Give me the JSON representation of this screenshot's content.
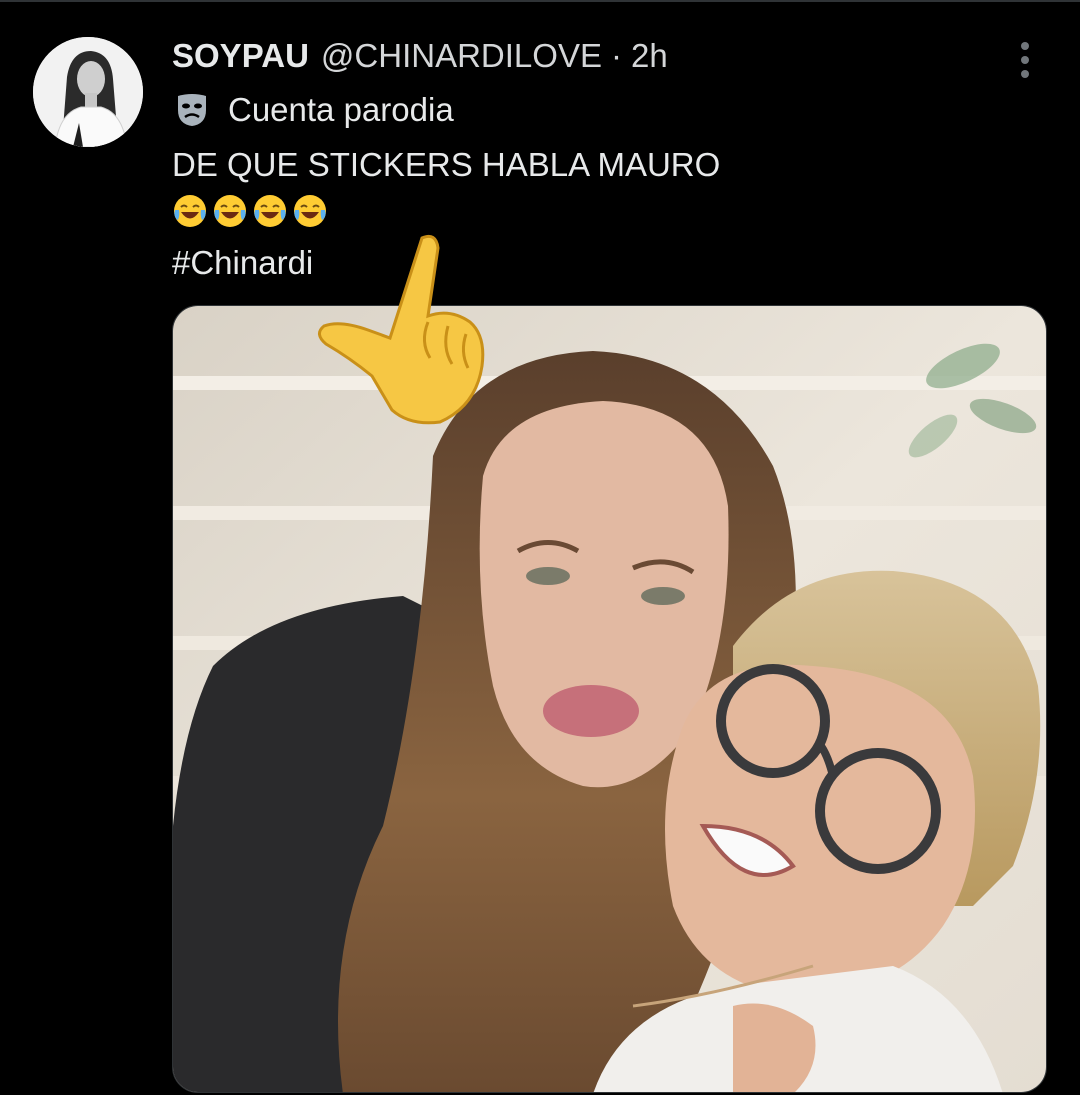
{
  "tweet": {
    "display_name": "SOYPAU",
    "handle": "@CHINARDILOVE",
    "separator": "·",
    "time": "2h",
    "parody_label": "Cuenta parodia",
    "text_line1": "DE QUE STICKERS HABLA MAURO",
    "text_line2_emojis": [
      "face-with-tears-of-joy",
      "face-with-tears-of-joy",
      "face-with-tears-of-joy",
      "face-with-tears-of-joy"
    ],
    "hashtag": "#Chinardi"
  },
  "icons": {
    "more": "more-options-icon",
    "parody": "parody-mask-icon",
    "overlay": "pointing-hand-icon"
  },
  "colors": {
    "background": "#000000",
    "primary_text": "#e7e9ea",
    "secondary_text": "#71767b",
    "divider": "#2f3336"
  }
}
